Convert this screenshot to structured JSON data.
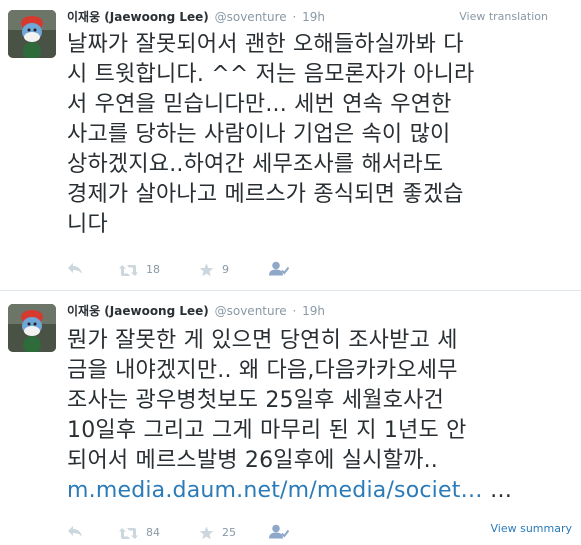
{
  "tweets": [
    {
      "fullname": "이재웅 (Jaewoong Lee)",
      "username": "@soventure",
      "separator": "·",
      "time": "19h",
      "header_link": "View translation",
      "text_lines": [
        "날짜가 잘못되어서 괜한 오해들하실까봐 다",
        "시 트윗합니다. ^^ 저는 음모론자가 아니라",
        "서 우연을 믿습니다만... 세번 연속 우연한",
        "사고를 당하는 사람이나 기업은 속이 많이",
        "상하겠지요..하여간 세무조사를 해서라도",
        "경제가 살아나고 메르스가 종식되면 좋겠습",
        "니다"
      ],
      "retweets": "18",
      "favorites": "9"
    },
    {
      "fullname": "이재웅 (Jaewoong Lee)",
      "username": "@soventure",
      "separator": "·",
      "time": "19h",
      "text_lines": [
        "뭔가 잘못한 게 있으면 당연히 조사받고 세",
        "금을 내야겠지만.. 왜 다음,다음카카오세무",
        "조사는 광우병첫보도 25일후 세월호사건",
        "10일후 그리고 그게 마무리 된 지 1년도 안",
        "되어서 메르스발병 26일후에 실시할까.."
      ],
      "link_text": "m.media.daum.net/m/media/societ…",
      "link_ellipsis": " …",
      "retweets": "84",
      "favorites": "25",
      "footer_link": "View summary"
    }
  ],
  "icons": {
    "reply": "reply-icon",
    "retweet": "retweet-icon",
    "favorite": "star-icon",
    "follow": "follow-user-icon"
  },
  "colors": {
    "text": "#292f33",
    "muted": "#8899a6",
    "link": "#2b7bb9",
    "border": "#e1e8ed"
  }
}
